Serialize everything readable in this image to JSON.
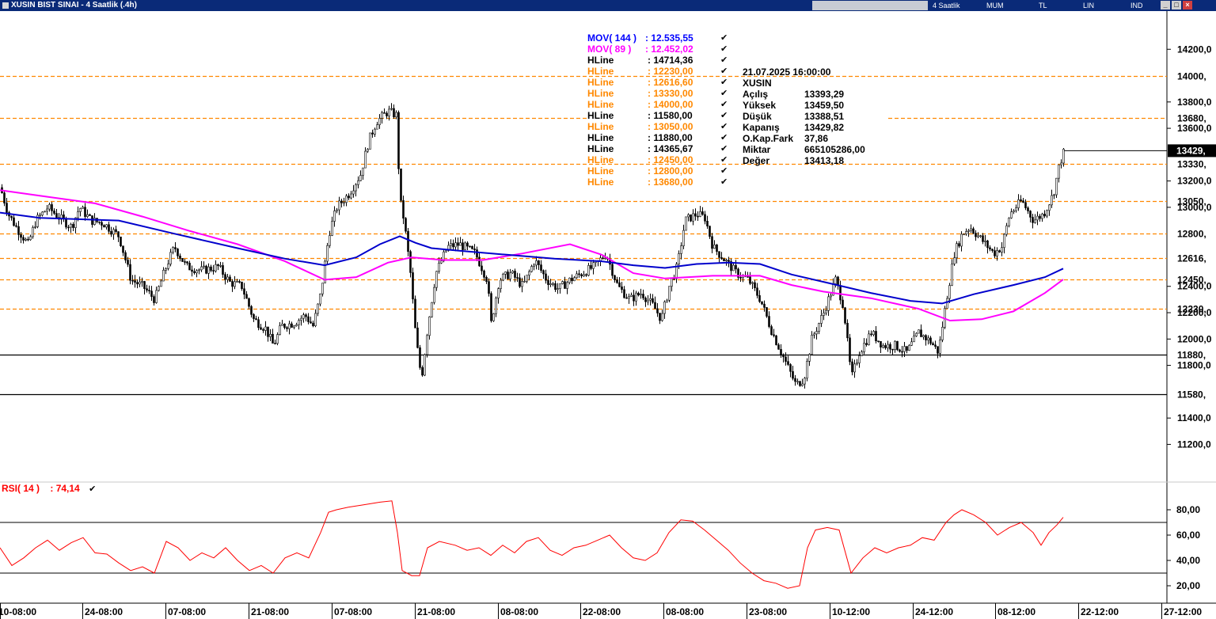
{
  "window": {
    "title": "XUSIN BIST SINAI - 4 Saatlik (.4h)",
    "timeframes": [
      "4 Saatlik",
      "MUM",
      "TL",
      "LIN",
      "IND"
    ],
    "buttons": {
      "minimize": "_",
      "restore": "□",
      "close": "×"
    }
  },
  "legend": [
    {
      "label": "MOV( 144 )",
      "value": ": 12.535,55",
      "color": "#0000ff"
    },
    {
      "label": "MOV( 89 )",
      "value": ": 12.452,02",
      "color": "#ff00ff"
    },
    {
      "label": "HLine",
      "value": ": 14714,36",
      "color": "#000000"
    },
    {
      "label": "HLine",
      "value": ": 12230,00",
      "color": "#ff8800"
    },
    {
      "label": "HLine",
      "value": ": 12616,60",
      "color": "#ff8800"
    },
    {
      "label": "HLine",
      "value": ": 13330,00",
      "color": "#ff8800"
    },
    {
      "label": "HLine",
      "value": ": 14000,00",
      "color": "#ff8800"
    },
    {
      "label": "HLine",
      "value": ": 11580,00",
      "color": "#000000"
    },
    {
      "label": "HLine",
      "value": ": 13050,00",
      "color": "#ff8800"
    },
    {
      "label": "HLine",
      "value": ": 11880,00",
      "color": "#000000"
    },
    {
      "label": "HLine",
      "value": ": 14365,67",
      "color": "#000000"
    },
    {
      "label": "HLine",
      "value": ": 12450,00",
      "color": "#ff8800"
    },
    {
      "label": "HLine",
      "value": ": 12800,00",
      "color": "#ff8800"
    },
    {
      "label": "HLine",
      "value": ": 13680,00",
      "color": "#ff8800"
    }
  ],
  "ohlc_info": {
    "datetime": "21.07.2025  16:00:00",
    "symbol": "XUSIN",
    "rows": [
      {
        "label": "Açılış",
        "value": "13393,29"
      },
      {
        "label": "Yüksek",
        "value": "13459,50"
      },
      {
        "label": "Düşük",
        "value": "13388,51"
      },
      {
        "label": "Kapanış",
        "value": "13429,82"
      },
      {
        "label": "O.Kap.Fark",
        "value": "37,86"
      },
      {
        "label": "Miktar",
        "value": "665105286,00"
      },
      {
        "label": "Değer",
        "value": "13413,18"
      }
    ]
  },
  "rsi_legend": {
    "label": "RSI( 14 )",
    "value": ": 74,14",
    "color": "#ff0000"
  },
  "chart_data": {
    "type": "candlestick",
    "price_axis": {
      "range": [
        10920,
        14490
      ],
      "ticks": [
        {
          "v": 14200,
          "t": "14200,0"
        },
        {
          "v": 13800,
          "t": "13800,0"
        },
        {
          "v": 13600,
          "t": "13600,0"
        },
        {
          "v": 13200,
          "t": "13200,0"
        },
        {
          "v": 13000,
          "t": "13000,0"
        },
        {
          "v": 12400,
          "t": "12400,0"
        },
        {
          "v": 12200,
          "t": "12200,0"
        },
        {
          "v": 12000,
          "t": "12000,0"
        },
        {
          "v": 11800,
          "t": "11800,0"
        },
        {
          "v": 11400,
          "t": "11400,0"
        },
        {
          "v": 11200,
          "t": "11200,0"
        }
      ]
    },
    "time_axis": [
      "10-08:00",
      "24-08:00",
      "07-08:00",
      "21-08:00",
      "07-08:00",
      "21-08:00",
      "08-08:00",
      "22-08:00",
      "08-08:00",
      "23-08:00",
      "10-12:00",
      "24-12:00",
      "08-12:00",
      "22-12:00",
      "27-12:00"
    ],
    "hlines": [
      {
        "value": 14000,
        "label": "14000,",
        "color": "#ff8800",
        "style": "dashed"
      },
      {
        "value": 13680,
        "label": "13680,",
        "color": "#ff8800",
        "style": "dashed"
      },
      {
        "value": 13330,
        "label": "13330,",
        "color": "#ff8800",
        "style": "dashed"
      },
      {
        "value": 13050,
        "label": "13050,",
        "color": "#ff8800",
        "style": "dashed"
      },
      {
        "value": 12800,
        "label": "12800,",
        "color": "#ff8800",
        "style": "dashed"
      },
      {
        "value": 12616.6,
        "label": "12616,",
        "color": "#ff8800",
        "style": "dashed"
      },
      {
        "value": 12450,
        "label": "12450,",
        "color": "#ff8800",
        "style": "dashed"
      },
      {
        "value": 12230,
        "label": "12230,",
        "color": "#ff8800",
        "style": "dashed"
      },
      {
        "value": 11880,
        "label": "11880,",
        "color": "#000000",
        "style": "solid"
      },
      {
        "value": 11580,
        "label": "11580,",
        "color": "#000000",
        "style": "solid"
      }
    ],
    "last_price": {
      "value": 13429.82,
      "label": "13429,"
    },
    "price_path": [
      [
        0,
        13150
      ],
      [
        10,
        12950
      ],
      [
        20,
        12850
      ],
      [
        35,
        12720
      ],
      [
        45,
        12900
      ],
      [
        60,
        13000
      ],
      [
        75,
        12920
      ],
      [
        90,
        12850
      ],
      [
        100,
        13000
      ],
      [
        115,
        12900
      ],
      [
        130,
        12880
      ],
      [
        150,
        12780
      ],
      [
        165,
        12450
      ],
      [
        180,
        12400
      ],
      [
        195,
        12300
      ],
      [
        210,
        12560
      ],
      [
        220,
        12700
      ],
      [
        235,
        12550
      ],
      [
        255,
        12520
      ],
      [
        275,
        12550
      ],
      [
        290,
        12430
      ],
      [
        305,
        12400
      ],
      [
        320,
        12150
      ],
      [
        335,
        12080
      ],
      [
        345,
        11950
      ],
      [
        355,
        12100
      ],
      [
        370,
        12120
      ],
      [
        385,
        12180
      ],
      [
        395,
        12100
      ],
      [
        405,
        12350
      ],
      [
        415,
        12800
      ],
      [
        425,
        13000
      ],
      [
        440,
        13100
      ],
      [
        455,
        13250
      ],
      [
        465,
        13500
      ],
      [
        475,
        13650
      ],
      [
        490,
        13730
      ],
      [
        500,
        13700
      ],
      [
        505,
        13050
      ],
      [
        510,
        12900
      ],
      [
        518,
        12500
      ],
      [
        525,
        12000
      ],
      [
        532,
        11700
      ],
      [
        540,
        12100
      ],
      [
        550,
        12500
      ],
      [
        565,
        12700
      ],
      [
        580,
        12720
      ],
      [
        600,
        12650
      ],
      [
        615,
        12450
      ],
      [
        620,
        12120
      ],
      [
        630,
        12450
      ],
      [
        645,
        12500
      ],
      [
        660,
        12400
      ],
      [
        675,
        12600
      ],
      [
        690,
        12450
      ],
      [
        705,
        12380
      ],
      [
        720,
        12450
      ],
      [
        735,
        12500
      ],
      [
        750,
        12550
      ],
      [
        765,
        12650
      ],
      [
        780,
        12400
      ],
      [
        795,
        12300
      ],
      [
        810,
        12350
      ],
      [
        825,
        12250
      ],
      [
        835,
        12150
      ],
      [
        845,
        12400
      ],
      [
        855,
        12550
      ],
      [
        865,
        12900
      ],
      [
        880,
        12950
      ],
      [
        890,
        12920
      ],
      [
        900,
        12700
      ],
      [
        915,
        12600
      ],
      [
        930,
        12500
      ],
      [
        945,
        12450
      ],
      [
        960,
        12300
      ],
      [
        975,
        12050
      ],
      [
        990,
        11850
      ],
      [
        1005,
        11650
      ],
      [
        1015,
        11700
      ],
      [
        1025,
        12000
      ],
      [
        1040,
        12200
      ],
      [
        1055,
        12450
      ],
      [
        1065,
        12250
      ],
      [
        1075,
        11700
      ],
      [
        1085,
        11900
      ],
      [
        1100,
        12050
      ],
      [
        1115,
        11950
      ],
      [
        1130,
        11950
      ],
      [
        1145,
        11900
      ],
      [
        1160,
        12050
      ],
      [
        1175,
        11980
      ],
      [
        1185,
        11900
      ],
      [
        1195,
        12300
      ],
      [
        1205,
        12650
      ],
      [
        1215,
        12800
      ],
      [
        1225,
        12850
      ],
      [
        1240,
        12750
      ],
      [
        1255,
        12650
      ],
      [
        1265,
        12700
      ],
      [
        1275,
        12950
      ],
      [
        1290,
        13050
      ],
      [
        1305,
        12900
      ],
      [
        1318,
        12950
      ],
      [
        1330,
        13100
      ],
      [
        1338,
        13330
      ],
      [
        1344,
        13429
      ]
    ],
    "ma144": {
      "name": "MOV( 144 )",
      "color": "#0000cc",
      "points": [
        [
          0,
          12960
        ],
        [
          50,
          12920
        ],
        [
          150,
          12900
        ],
        [
          220,
          12800
        ],
        [
          300,
          12690
        ],
        [
          360,
          12610
        ],
        [
          410,
          12560
        ],
        [
          450,
          12620
        ],
        [
          480,
          12720
        ],
        [
          505,
          12780
        ],
        [
          525,
          12730
        ],
        [
          545,
          12690
        ],
        [
          580,
          12670
        ],
        [
          640,
          12640
        ],
        [
          700,
          12610
        ],
        [
          760,
          12590
        ],
        [
          800,
          12560
        ],
        [
          840,
          12540
        ],
        [
          880,
          12570
        ],
        [
          920,
          12580
        ],
        [
          960,
          12570
        ],
        [
          1000,
          12490
        ],
        [
          1050,
          12420
        ],
        [
          1100,
          12350
        ],
        [
          1150,
          12290
        ],
        [
          1190,
          12270
        ],
        [
          1230,
          12340
        ],
        [
          1280,
          12410
        ],
        [
          1320,
          12470
        ],
        [
          1343,
          12535
        ]
      ]
    },
    "ma89": {
      "name": "MOV( 89 )",
      "color": "#ff00ff",
      "points": [
        [
          0,
          13130
        ],
        [
          60,
          13080
        ],
        [
          120,
          13030
        ],
        [
          180,
          12930
        ],
        [
          240,
          12820
        ],
        [
          300,
          12720
        ],
        [
          360,
          12590
        ],
        [
          410,
          12450
        ],
        [
          450,
          12470
        ],
        [
          490,
          12580
        ],
        [
          520,
          12620
        ],
        [
          560,
          12600
        ],
        [
          610,
          12600
        ],
        [
          660,
          12650
        ],
        [
          720,
          12720
        ],
        [
          760,
          12640
        ],
        [
          800,
          12500
        ],
        [
          840,
          12460
        ],
        [
          900,
          12480
        ],
        [
          960,
          12480
        ],
        [
          1000,
          12410
        ],
        [
          1040,
          12360
        ],
        [
          1100,
          12310
        ],
        [
          1160,
          12230
        ],
        [
          1200,
          12140
        ],
        [
          1240,
          12150
        ],
        [
          1280,
          12210
        ],
        [
          1320,
          12350
        ],
        [
          1343,
          12452
        ]
      ]
    }
  },
  "rsi": {
    "axis": {
      "range": [
        10,
        90
      ],
      "ticks": [
        {
          "v": 80,
          "t": "80,00"
        },
        {
          "v": 60,
          "t": "60,00"
        },
        {
          "v": 40,
          "t": "40,00"
        },
        {
          "v": 20,
          "t": "20,00"
        }
      ]
    },
    "levels": [
      70,
      30
    ],
    "color": "#ff0000",
    "points": [
      [
        0,
        50
      ],
      [
        15,
        36
      ],
      [
        30,
        42
      ],
      [
        45,
        50
      ],
      [
        60,
        56
      ],
      [
        75,
        48
      ],
      [
        90,
        54
      ],
      [
        105,
        58
      ],
      [
        120,
        46
      ],
      [
        135,
        45
      ],
      [
        150,
        38
      ],
      [
        165,
        32
      ],
      [
        180,
        35
      ],
      [
        195,
        30
      ],
      [
        210,
        55
      ],
      [
        225,
        50
      ],
      [
        240,
        40
      ],
      [
        255,
        46
      ],
      [
        270,
        42
      ],
      [
        285,
        50
      ],
      [
        300,
        40
      ],
      [
        315,
        32
      ],
      [
        330,
        36
      ],
      [
        345,
        30
      ],
      [
        360,
        42
      ],
      [
        375,
        46
      ],
      [
        390,
        42
      ],
      [
        405,
        62
      ],
      [
        415,
        78
      ],
      [
        425,
        80
      ],
      [
        440,
        82
      ],
      [
        460,
        84
      ],
      [
        480,
        86
      ],
      [
        495,
        87
      ],
      [
        502,
        62
      ],
      [
        508,
        32
      ],
      [
        520,
        28
      ],
      [
        530,
        28
      ],
      [
        540,
        50
      ],
      [
        555,
        55
      ],
      [
        575,
        52
      ],
      [
        590,
        48
      ],
      [
        605,
        50
      ],
      [
        620,
        44
      ],
      [
        635,
        52
      ],
      [
        650,
        46
      ],
      [
        665,
        55
      ],
      [
        680,
        58
      ],
      [
        695,
        48
      ],
      [
        710,
        44
      ],
      [
        725,
        50
      ],
      [
        740,
        52
      ],
      [
        755,
        56
      ],
      [
        770,
        60
      ],
      [
        785,
        50
      ],
      [
        800,
        42
      ],
      [
        815,
        40
      ],
      [
        830,
        46
      ],
      [
        845,
        62
      ],
      [
        860,
        72
      ],
      [
        875,
        71
      ],
      [
        890,
        64
      ],
      [
        905,
        56
      ],
      [
        920,
        48
      ],
      [
        935,
        38
      ],
      [
        950,
        30
      ],
      [
        965,
        24
      ],
      [
        980,
        22
      ],
      [
        995,
        18
      ],
      [
        1010,
        20
      ],
      [
        1020,
        50
      ],
      [
        1030,
        64
      ],
      [
        1045,
        66
      ],
      [
        1060,
        64
      ],
      [
        1075,
        30
      ],
      [
        1090,
        42
      ],
      [
        1105,
        50
      ],
      [
        1120,
        46
      ],
      [
        1135,
        50
      ],
      [
        1150,
        52
      ],
      [
        1165,
        58
      ],
      [
        1180,
        56
      ],
      [
        1195,
        70
      ],
      [
        1205,
        76
      ],
      [
        1215,
        80
      ],
      [
        1230,
        76
      ],
      [
        1245,
        70
      ],
      [
        1260,
        60
      ],
      [
        1275,
        66
      ],
      [
        1290,
        70
      ],
      [
        1305,
        62
      ],
      [
        1315,
        52
      ],
      [
        1325,
        62
      ],
      [
        1335,
        68
      ],
      [
        1343,
        74
      ]
    ]
  }
}
